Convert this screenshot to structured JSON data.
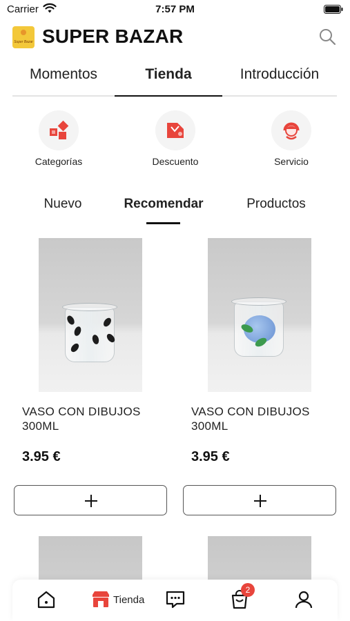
{
  "status_bar": {
    "carrier": "Carrier",
    "time": "7:57 PM"
  },
  "header": {
    "title": "SUPER BAZAR",
    "logo_text": "Super Bazar"
  },
  "top_tabs": [
    {
      "label": "Momentos",
      "active": false
    },
    {
      "label": "Tienda",
      "active": true
    },
    {
      "label": "Introducción",
      "active": false
    }
  ],
  "quick_actions": [
    {
      "label": "Categorías",
      "icon": "categories-icon"
    },
    {
      "label": "Descuento",
      "icon": "discount-tag-icon"
    },
    {
      "label": "Servicio",
      "icon": "customer-service-icon"
    }
  ],
  "sub_tabs": [
    {
      "label": "Nuevo",
      "active": false
    },
    {
      "label": "Recomendar",
      "active": true
    },
    {
      "label": "Productos",
      "active": false
    }
  ],
  "products": [
    {
      "name": "VASO CON DIBUJOS 300ML",
      "price": "3.95 €",
      "image": "glass-black-leaves"
    },
    {
      "name": "VASO CON DIBUJOS 300ML",
      "price": "3.95 €",
      "image": "glass-blue-hydrangea"
    }
  ],
  "bottom_nav": {
    "items": [
      {
        "name": "home",
        "icon": "home-icon"
      },
      {
        "name": "store",
        "icon": "store-icon",
        "label": "Tienda",
        "active": true
      },
      {
        "name": "messages",
        "icon": "chat-icon"
      },
      {
        "name": "cart",
        "icon": "shopping-bag-icon",
        "badge": "2"
      },
      {
        "name": "profile",
        "icon": "user-icon"
      }
    ]
  },
  "colors": {
    "accent": "#e8453c",
    "text": "#111111",
    "divider": "#e3e3e3"
  }
}
